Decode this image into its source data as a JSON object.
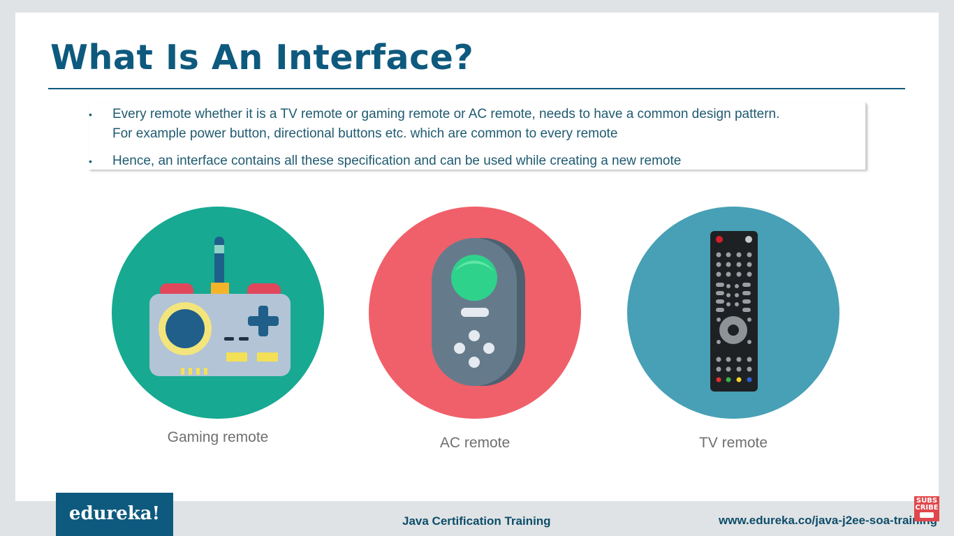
{
  "slide": {
    "title": "What Is An Interface?",
    "bullets": [
      {
        "line1": "Every remote whether it is a TV remote or gaming remote or AC remote, needs to have a common design pattern.",
        "line2": "For example power button, directional buttons etc. which are common to every remote"
      },
      {
        "line1": "Hence, an interface contains all these specification and can be used while creating a new remote"
      }
    ],
    "remotes": [
      {
        "label": "Gaming remote",
        "circle_color": "#17a991",
        "icon": "gamepad-icon"
      },
      {
        "label": "AC remote",
        "circle_color": "#f0606a",
        "icon": "ac-remote-icon"
      },
      {
        "label": "TV remote",
        "circle_color": "#47a0b5",
        "icon": "tv-remote-icon"
      }
    ]
  },
  "footer": {
    "logo": "edureka!",
    "course": "Java Certification Training",
    "url": "www.edureka.co/java-j2ee-soa-training",
    "subscribe": [
      "SUBS",
      "CRIBE"
    ]
  },
  "colors": {
    "title": "#0e5a7e",
    "bullet_text": "#1f5a70",
    "logo_bg": "#0e5a7e",
    "subscribe_bg": "#e0474c"
  }
}
